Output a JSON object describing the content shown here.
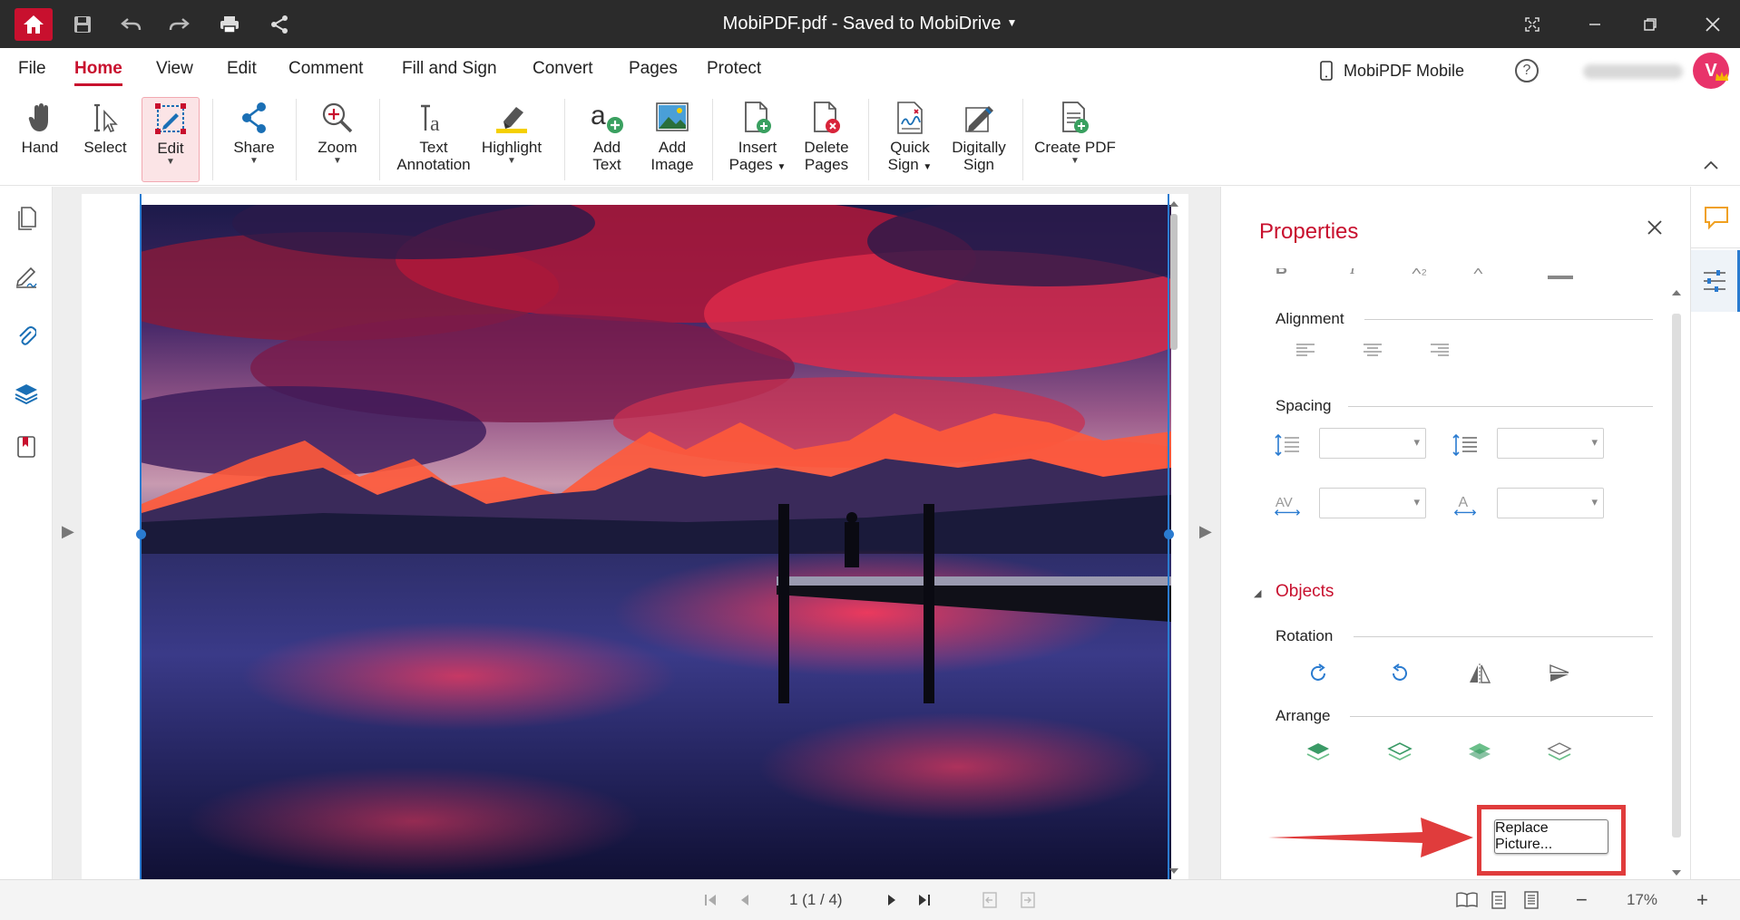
{
  "titlebar": {
    "title": "MobiPDF.pdf - Saved to MobiDrive",
    "home_icon": "home-icon",
    "save_icon": "save-icon",
    "undo_icon": "undo-icon",
    "redo_icon": "redo-icon",
    "print_icon": "print-icon",
    "share_icon": "share-icon",
    "fullscreen_icon": "fullscreen-icon",
    "minimize_icon": "minimize-icon",
    "maximize_icon": "maximize-icon",
    "close_icon": "close-icon"
  },
  "menu": {
    "items": [
      "File",
      "Home",
      "View",
      "Edit",
      "Comment",
      "Fill and Sign",
      "Convert",
      "Pages",
      "Protect"
    ],
    "active": "Home",
    "mobile_label": "MobiPDF Mobile",
    "help": "?",
    "avatar_letter": "V"
  },
  "ribbon": {
    "hand": "Hand",
    "select": "Select",
    "edit": "Edit",
    "share": "Share",
    "zoom": "Zoom",
    "text_annotation_1": "Text",
    "text_annotation_2": "Annotation",
    "highlight": "Highlight",
    "add_text_1": "Add",
    "add_text_2": "Text",
    "add_image_1": "Add",
    "add_image_2": "Image",
    "insert_pages_1": "Insert",
    "insert_pages_2": "Pages",
    "delete_pages_1": "Delete",
    "delete_pages_2": "Pages",
    "quick_sign_1": "Quick",
    "quick_sign_2": "Sign",
    "digitally_sign_1": "Digitally",
    "digitally_sign_2": "Sign",
    "create_pdf": "Create PDF"
  },
  "properties": {
    "title": "Properties",
    "alignment": "Alignment",
    "spacing": "Spacing",
    "objects": "Objects",
    "rotation": "Rotation",
    "arrange": "Arrange",
    "replace_button": "Replace Picture..."
  },
  "statusbar": {
    "page_indicator": "1 (1 / 4)",
    "zoom": "17%",
    "minus": "−",
    "plus": "+"
  },
  "colors": {
    "brand": "#c8102e",
    "titlebar": "#2b2b2b",
    "selection": "#2a7bd0",
    "callout": "#e03c3c",
    "icon_blue": "#1a6fb5",
    "icon_green": "#6bbf8a"
  }
}
